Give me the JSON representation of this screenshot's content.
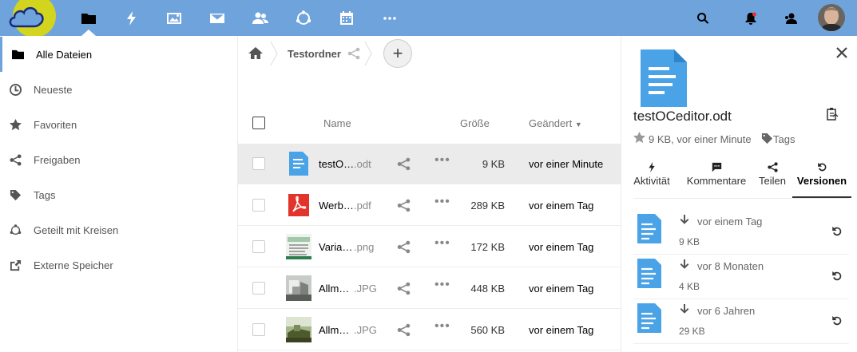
{
  "header": {
    "apps": [
      "folder-icon",
      "activity-icon",
      "gallery-icon",
      "mail-icon",
      "contacts-icon",
      "circles-icon",
      "calendar-icon",
      "more-apps-icon"
    ],
    "active_app": "folder-icon",
    "right_icons": [
      "search-icon",
      "notifications-icon",
      "contacts-menu-icon",
      "avatar"
    ],
    "accent_color": "#6fa3dc"
  },
  "sidebar": {
    "items": [
      {
        "label": "Alle Dateien",
        "icon": "folder-icon",
        "active": true
      },
      {
        "label": "Neueste",
        "icon": "clock-icon"
      },
      {
        "label": "Favoriten",
        "icon": "star-icon"
      },
      {
        "label": "Freigaben",
        "icon": "share-icon"
      },
      {
        "label": "Tags",
        "icon": "tag-icon"
      },
      {
        "label": "Geteilt mit Kreisen",
        "icon": "circles-icon"
      },
      {
        "label": "Externe Speicher",
        "icon": "external-link-icon"
      }
    ]
  },
  "breadcrumb": {
    "folder": "Testordner",
    "add_label": "+"
  },
  "table": {
    "headers": {
      "name": "Name",
      "size": "Größe",
      "modified": "Geändert"
    },
    "rows": [
      {
        "name": "testO…",
        "ext": ".odt",
        "size": "9 KB",
        "modified": "vor einer Minute",
        "type": "document",
        "selected": true
      },
      {
        "name": "Werb…",
        "ext": ".pdf",
        "size": "289 KB",
        "modified": "vor einem Tag",
        "type": "pdf"
      },
      {
        "name": "Varia…",
        "ext": ".png",
        "size": "172 KB",
        "modified": "vor einem Tag",
        "type": "image"
      },
      {
        "name": "Allm…",
        "ext": ".JPG",
        "size": "448 KB",
        "modified": "vor einem Tag",
        "type": "photo"
      },
      {
        "name": "Allm…",
        "ext": ".JPG",
        "size": "560 KB",
        "modified": "vor einem Tag",
        "type": "photo2"
      }
    ]
  },
  "details": {
    "filename": "testOCeditor.odt",
    "meta": "9 KB, vor einer Minute",
    "tags_label": "Tags",
    "tabs": [
      {
        "label": "Aktivität",
        "icon": "activity-icon"
      },
      {
        "label": "Kommentare",
        "icon": "comment-icon"
      },
      {
        "label": "Teilen",
        "icon": "share-icon"
      },
      {
        "label": "Versionen",
        "icon": "history-icon",
        "active": true
      }
    ],
    "versions": [
      {
        "date": "vor einem Tag",
        "size": "9 KB"
      },
      {
        "date": "vor 8 Monaten",
        "size": "4 KB"
      },
      {
        "date": "vor 6 Jahren",
        "size": "29 KB"
      }
    ]
  }
}
